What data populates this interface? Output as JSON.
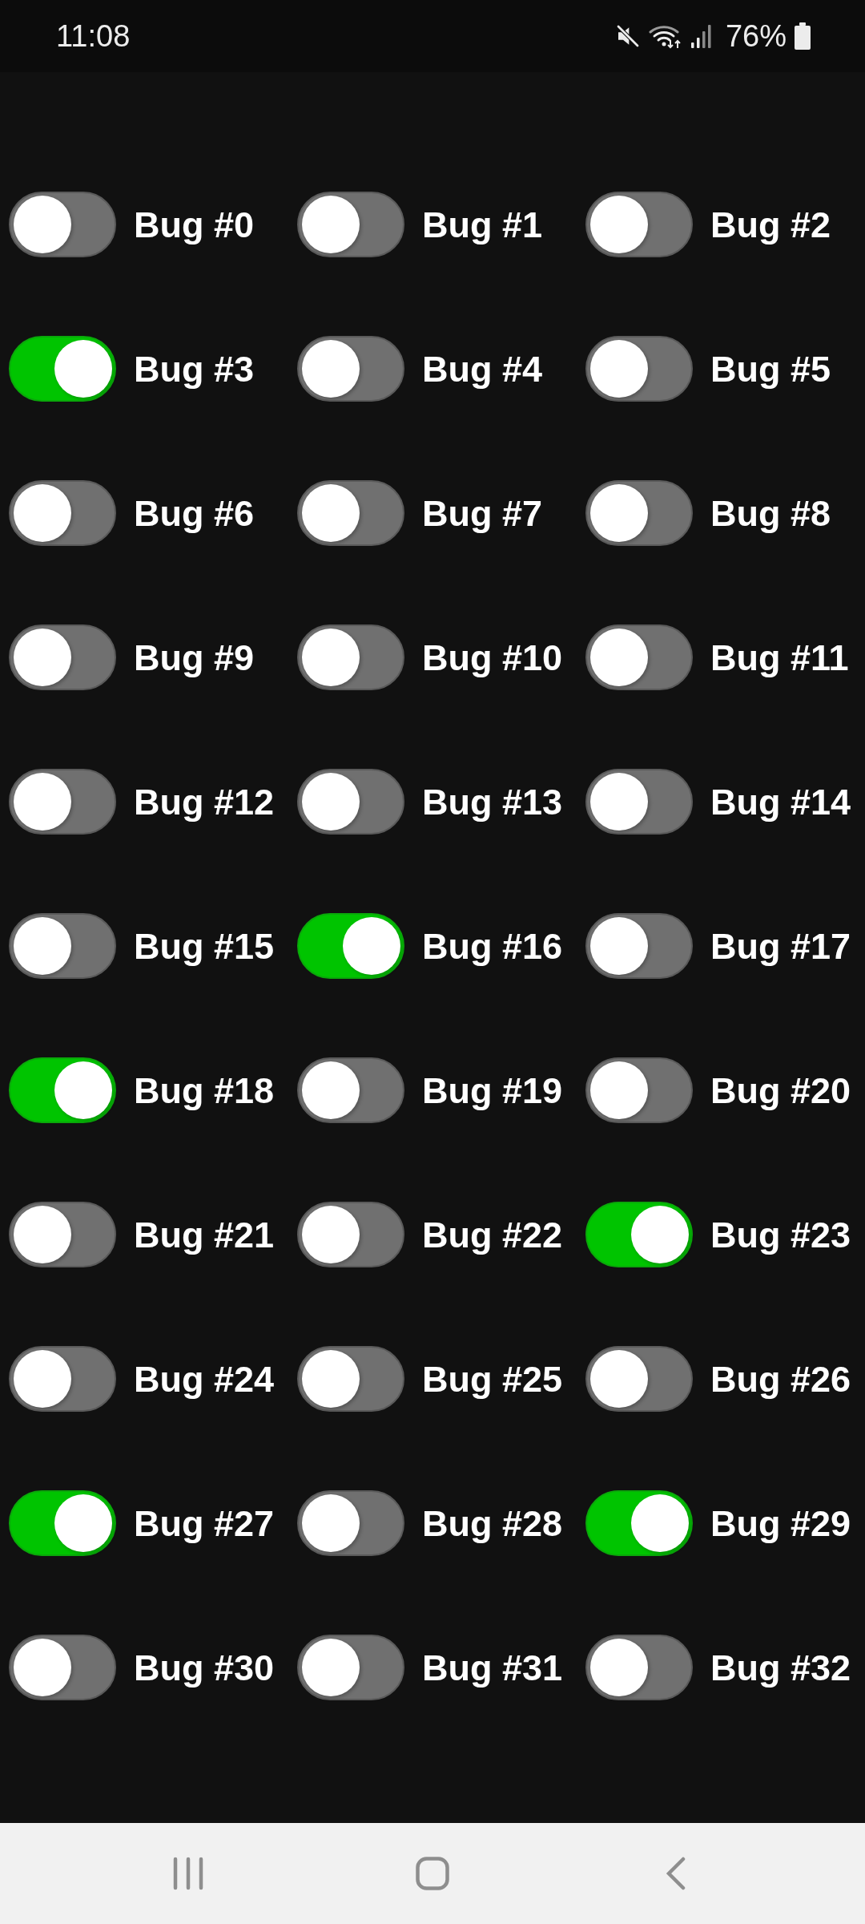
{
  "status_bar": {
    "time": "11:08",
    "battery": "76%"
  },
  "switches": [
    {
      "label": "Bug #0",
      "on": false
    },
    {
      "label": "Bug #1",
      "on": false
    },
    {
      "label": "Bug #2",
      "on": false
    },
    {
      "label": "Bug #3",
      "on": true
    },
    {
      "label": "Bug #4",
      "on": false
    },
    {
      "label": "Bug #5",
      "on": false
    },
    {
      "label": "Bug #6",
      "on": false
    },
    {
      "label": "Bug #7",
      "on": false
    },
    {
      "label": "Bug #8",
      "on": false
    },
    {
      "label": "Bug #9",
      "on": false
    },
    {
      "label": "Bug #10",
      "on": false
    },
    {
      "label": "Bug #11",
      "on": false
    },
    {
      "label": "Bug #12",
      "on": false
    },
    {
      "label": "Bug #13",
      "on": false
    },
    {
      "label": "Bug #14",
      "on": false
    },
    {
      "label": "Bug #15",
      "on": false
    },
    {
      "label": "Bug #16",
      "on": true
    },
    {
      "label": "Bug #17",
      "on": false
    },
    {
      "label": "Bug #18",
      "on": true
    },
    {
      "label": "Bug #19",
      "on": false
    },
    {
      "label": "Bug #20",
      "on": false
    },
    {
      "label": "Bug #21",
      "on": false
    },
    {
      "label": "Bug #22",
      "on": false
    },
    {
      "label": "Bug #23",
      "on": true
    },
    {
      "label": "Bug #24",
      "on": false
    },
    {
      "label": "Bug #25",
      "on": false
    },
    {
      "label": "Bug #26",
      "on": false
    },
    {
      "label": "Bug #27",
      "on": true
    },
    {
      "label": "Bug #28",
      "on": false
    },
    {
      "label": "Bug #29",
      "on": true
    },
    {
      "label": "Bug #30",
      "on": false
    },
    {
      "label": "Bug #31",
      "on": false
    },
    {
      "label": "Bug #32",
      "on": false
    }
  ]
}
